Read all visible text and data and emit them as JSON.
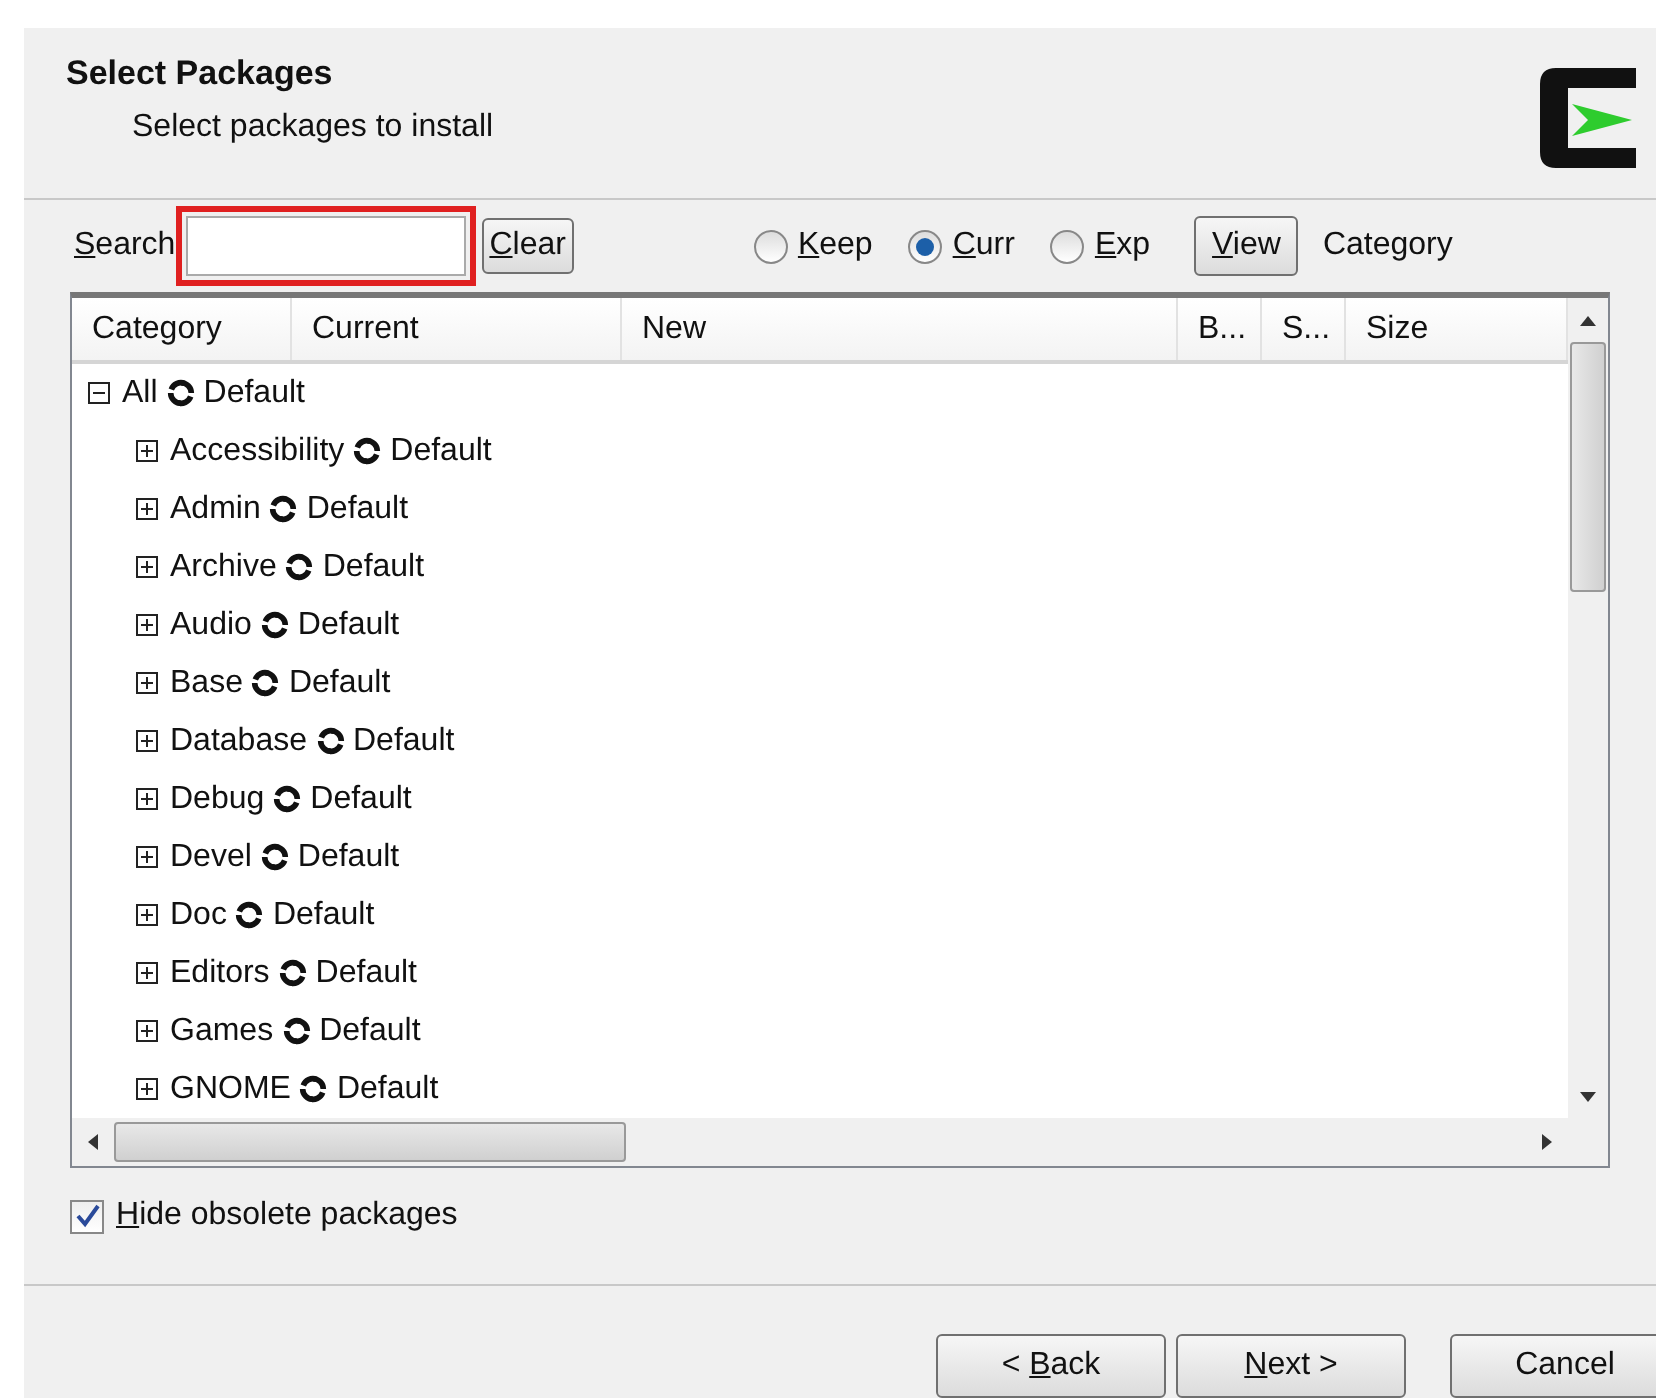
{
  "header": {
    "title": "Select Packages",
    "subtitle": "Select packages to install"
  },
  "search": {
    "label": "Search",
    "mnemonic": true,
    "highlighted": true
  },
  "clear_button": {
    "label": "Clear",
    "mnemonic": true
  },
  "view_modes": [
    {
      "label": "Keep",
      "selected": false,
      "mnemonic": true
    },
    {
      "label": "Curr",
      "selected": true,
      "mnemonic": true
    },
    {
      "label": "Exp",
      "selected": false,
      "mnemonic": true
    }
  ],
  "view_button": {
    "label": "View",
    "mnemonic": true
  },
  "view_label": "Category",
  "table": {
    "columns": [
      "Category",
      "Current",
      "New",
      "B...",
      "S...",
      "Size"
    ],
    "tree": [
      {
        "name": "All",
        "action": "Default",
        "expanded": true,
        "children": [
          {
            "name": "Accessibility",
            "action": "Default",
            "expanded": false
          },
          {
            "name": "Admin",
            "action": "Default",
            "expanded": false
          },
          {
            "name": "Archive",
            "action": "Default",
            "expanded": false
          },
          {
            "name": "Audio",
            "action": "Default",
            "expanded": false
          },
          {
            "name": "Base",
            "action": "Default",
            "expanded": false
          },
          {
            "name": "Database",
            "action": "Default",
            "expanded": false
          },
          {
            "name": "Debug",
            "action": "Default",
            "expanded": false
          },
          {
            "name": "Devel",
            "action": "Default",
            "expanded": false
          },
          {
            "name": "Doc",
            "action": "Default",
            "expanded": false
          },
          {
            "name": "Editors",
            "action": "Default",
            "expanded": false
          },
          {
            "name": "Games",
            "action": "Default",
            "expanded": false
          },
          {
            "name": "GNOME",
            "action": "Default",
            "expanded": false
          }
        ]
      }
    ]
  },
  "hide_obsolete": {
    "label": "Hide obsolete packages",
    "checked": true,
    "mnemonic": true
  },
  "buttons": [
    {
      "label": "< Back",
      "mnemonic": true
    },
    {
      "label": "Next >",
      "mnemonic": true
    },
    {
      "label": "Cancel",
      "mnemonic": false
    }
  ]
}
